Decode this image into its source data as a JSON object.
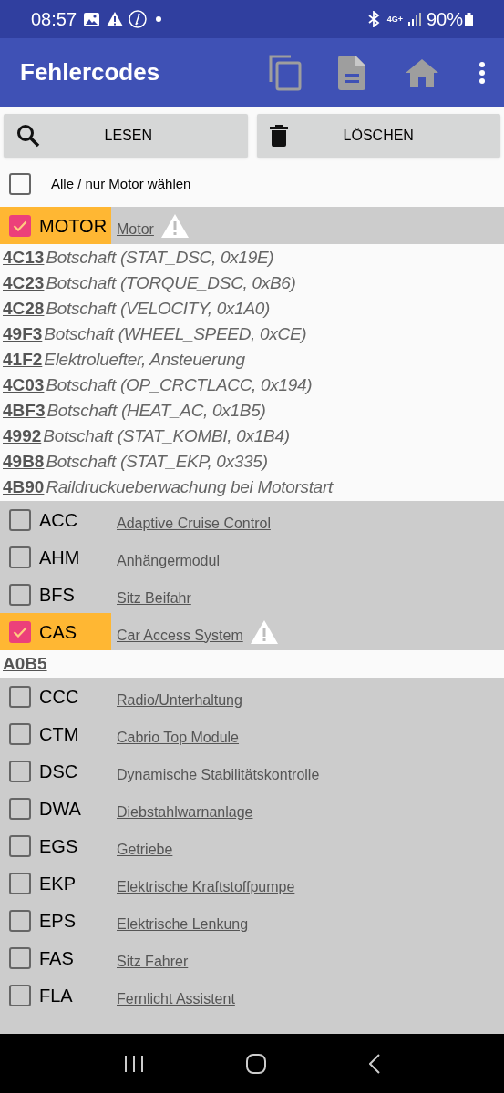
{
  "status_bar": {
    "time": "08:57",
    "network": "4G+",
    "battery": "90%"
  },
  "app_bar": {
    "title": "Fehlercodes"
  },
  "buttons": [
    {
      "kind": "read",
      "label": "LESEN"
    },
    {
      "kind": "delete",
      "label": "LÖSCHEN"
    }
  ],
  "select_all": {
    "label": "Alle / nur Motor wählen",
    "checked": false
  },
  "modules": [
    {
      "code": "MOTOR",
      "name": "Motor",
      "checked": true,
      "warning": true,
      "faults": [
        {
          "code": "4C13",
          "description": "Botschaft (STAT_DSC, 0x19E)"
        },
        {
          "code": "4C23",
          "description": "Botschaft (TORQUE_DSC, 0xB6)"
        },
        {
          "code": "4C28",
          "description": "Botschaft (VELOCITY, 0x1A0)"
        },
        {
          "code": "49F3",
          "description": "Botschaft (WHEEL_SPEED, 0xCE)"
        },
        {
          "code": "41F2",
          "description": "Elektroluefter, Ansteuerung"
        },
        {
          "code": "4C03",
          "description": "Botschaft (OP_CRCTLACC, 0x194)"
        },
        {
          "code": "4BF3",
          "description": "Botschaft (HEAT_AC, 0x1B5)"
        },
        {
          "code": "4992",
          "description": "Botschaft (STAT_KOMBI, 0x1B4)"
        },
        {
          "code": "49B8",
          "description": "Botschaft (STAT_EKP, 0x335)"
        },
        {
          "code": "4B90",
          "description": "Raildruckueberwachung bei Motorstart"
        }
      ]
    },
    {
      "code": "ACC",
      "name": "Adaptive Cruise Control",
      "checked": false,
      "warning": false
    },
    {
      "code": "AHM",
      "name": "Anhängermodul",
      "checked": false,
      "warning": false
    },
    {
      "code": "BFS",
      "name": "Sitz Beifahr",
      "checked": false,
      "warning": false
    },
    {
      "code": "CAS",
      "name": "Car Access System",
      "checked": true,
      "warning": true,
      "faults": [
        {
          "code": "A0B5"
        }
      ]
    },
    {
      "code": "CCC",
      "name": "Radio/Unterhaltung",
      "checked": false,
      "warning": false
    },
    {
      "code": "CTM",
      "name": "Cabrio Top Module",
      "checked": false,
      "warning": false
    },
    {
      "code": "DSC",
      "name": "Dynamische Stabilitätskontrolle",
      "checked": false,
      "warning": false
    },
    {
      "code": "DWA",
      "name": "Diebstahlwarnanlage",
      "checked": false,
      "warning": false
    },
    {
      "code": "EGS",
      "name": "Getriebe",
      "checked": false,
      "warning": false
    },
    {
      "code": "EKP",
      "name": "Elektrische Kraftstoffpumpe",
      "checked": false,
      "warning": false
    },
    {
      "code": "EPS",
      "name": "Elektrische Lenkung",
      "checked": false,
      "warning": false
    },
    {
      "code": "FAS",
      "name": "Sitz Fahrer",
      "checked": false,
      "warning": false
    },
    {
      "code": "FLA",
      "name": "Fernlicht Assistent",
      "checked": false,
      "warning": false
    }
  ]
}
